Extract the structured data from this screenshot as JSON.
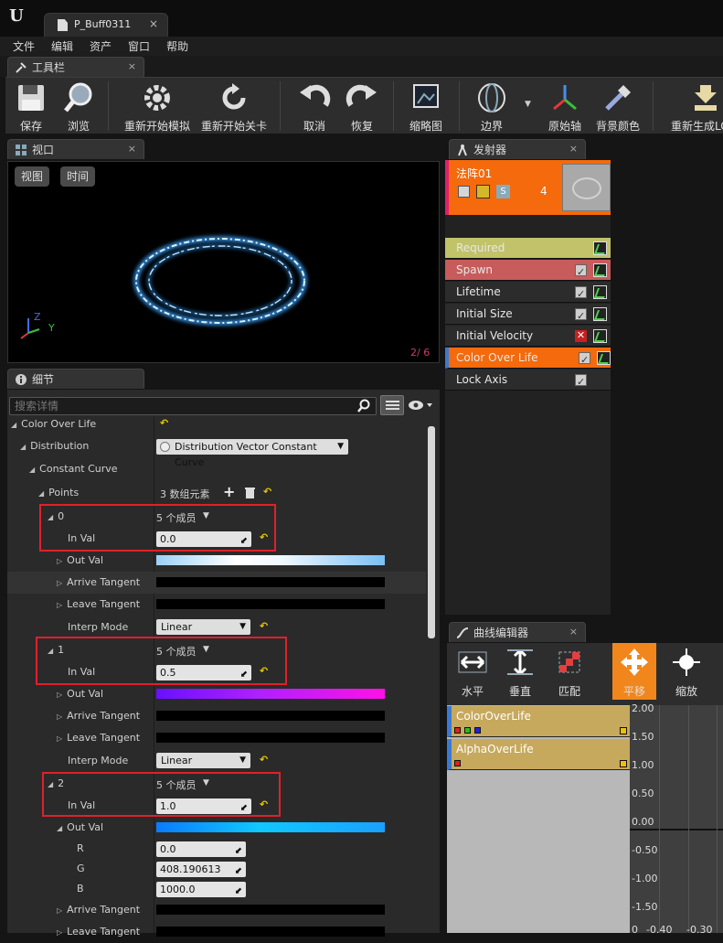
{
  "window": {
    "doc_tab": "P_Buff0311",
    "close_glyph": "×"
  },
  "menu": [
    "文件",
    "编辑",
    "资产",
    "窗口",
    "帮助"
  ],
  "toolbar_tab": "工具栏",
  "toolbar": {
    "save": "保存",
    "browse": "浏览",
    "restart_sim": "重新开始模拟",
    "restart_level": "重新开始关卡",
    "undo": "取消",
    "redo": "恢复",
    "thumbnail": "缩略图",
    "bounds": "边界",
    "origin_axis": "原始轴",
    "bg_color": "背景颜色",
    "regen_lod": "重新生成LOD"
  },
  "viewport": {
    "tab": "视口",
    "view_btn": "视图",
    "time_btn": "时间",
    "counter": "2/ 6",
    "axis_z": "Z",
    "axis_y": "Y"
  },
  "details": {
    "tab": "细节",
    "search_placeholder": "搜索详情",
    "rows": {
      "color_over_life": "Color Over Life",
      "distribution": "Distribution",
      "distribution_value": "Distribution Vector Constant Curve",
      "constant_curve": "Constant Curve",
      "points": "Points",
      "points_count": "3 数组元素",
      "p0": "0",
      "p0_members": "5 个成员",
      "in_val": "In Val",
      "p0_inval": "0.0",
      "out_val": "Out Val",
      "arrive_tangent": "Arrive Tangent",
      "leave_tangent": "Leave Tangent",
      "interp_mode": "Interp Mode",
      "interp_value": "Linear",
      "p1": "1",
      "p1_members": "5 个成员",
      "p1_inval": "0.5",
      "p2": "2",
      "p2_members": "5 个成员",
      "p2_inval": "1.0",
      "r": "R",
      "g": "G",
      "b": "B",
      "r_val": "0.0",
      "g_val": "408.190613",
      "b_val": "1000.0"
    }
  },
  "emitters": {
    "tab": "发射器",
    "emitter_name": "法阵01",
    "emitter_count": "4",
    "badge_s": "S",
    "modules": [
      "Required",
      "Spawn",
      "Lifetime",
      "Initial Size",
      "Initial Velocity",
      "Color Over Life",
      "Lock Axis"
    ]
  },
  "curve_editor": {
    "tab": "曲线编辑器",
    "tools": {
      "horizontal": "水平",
      "vertical": "垂直",
      "fit": "匹配",
      "pan": "平移",
      "zoom": "缩放"
    },
    "curves": [
      "ColorOverLife",
      "AlphaOverLife"
    ],
    "y_labels": [
      "2.00",
      "1.50",
      "1.00",
      "0.50",
      "0.00",
      "-0.50",
      "-1.00",
      "-1.50"
    ],
    "x_labels": [
      "0",
      "-0.40",
      "-0.30"
    ]
  },
  "colors": {
    "emitter_orange": "#f46a0c",
    "required_yellow": "#c2c26a",
    "spawn_red": "#c85b5b",
    "module_highlight": "#f46a0c",
    "curve_item": "#c7a95d"
  }
}
